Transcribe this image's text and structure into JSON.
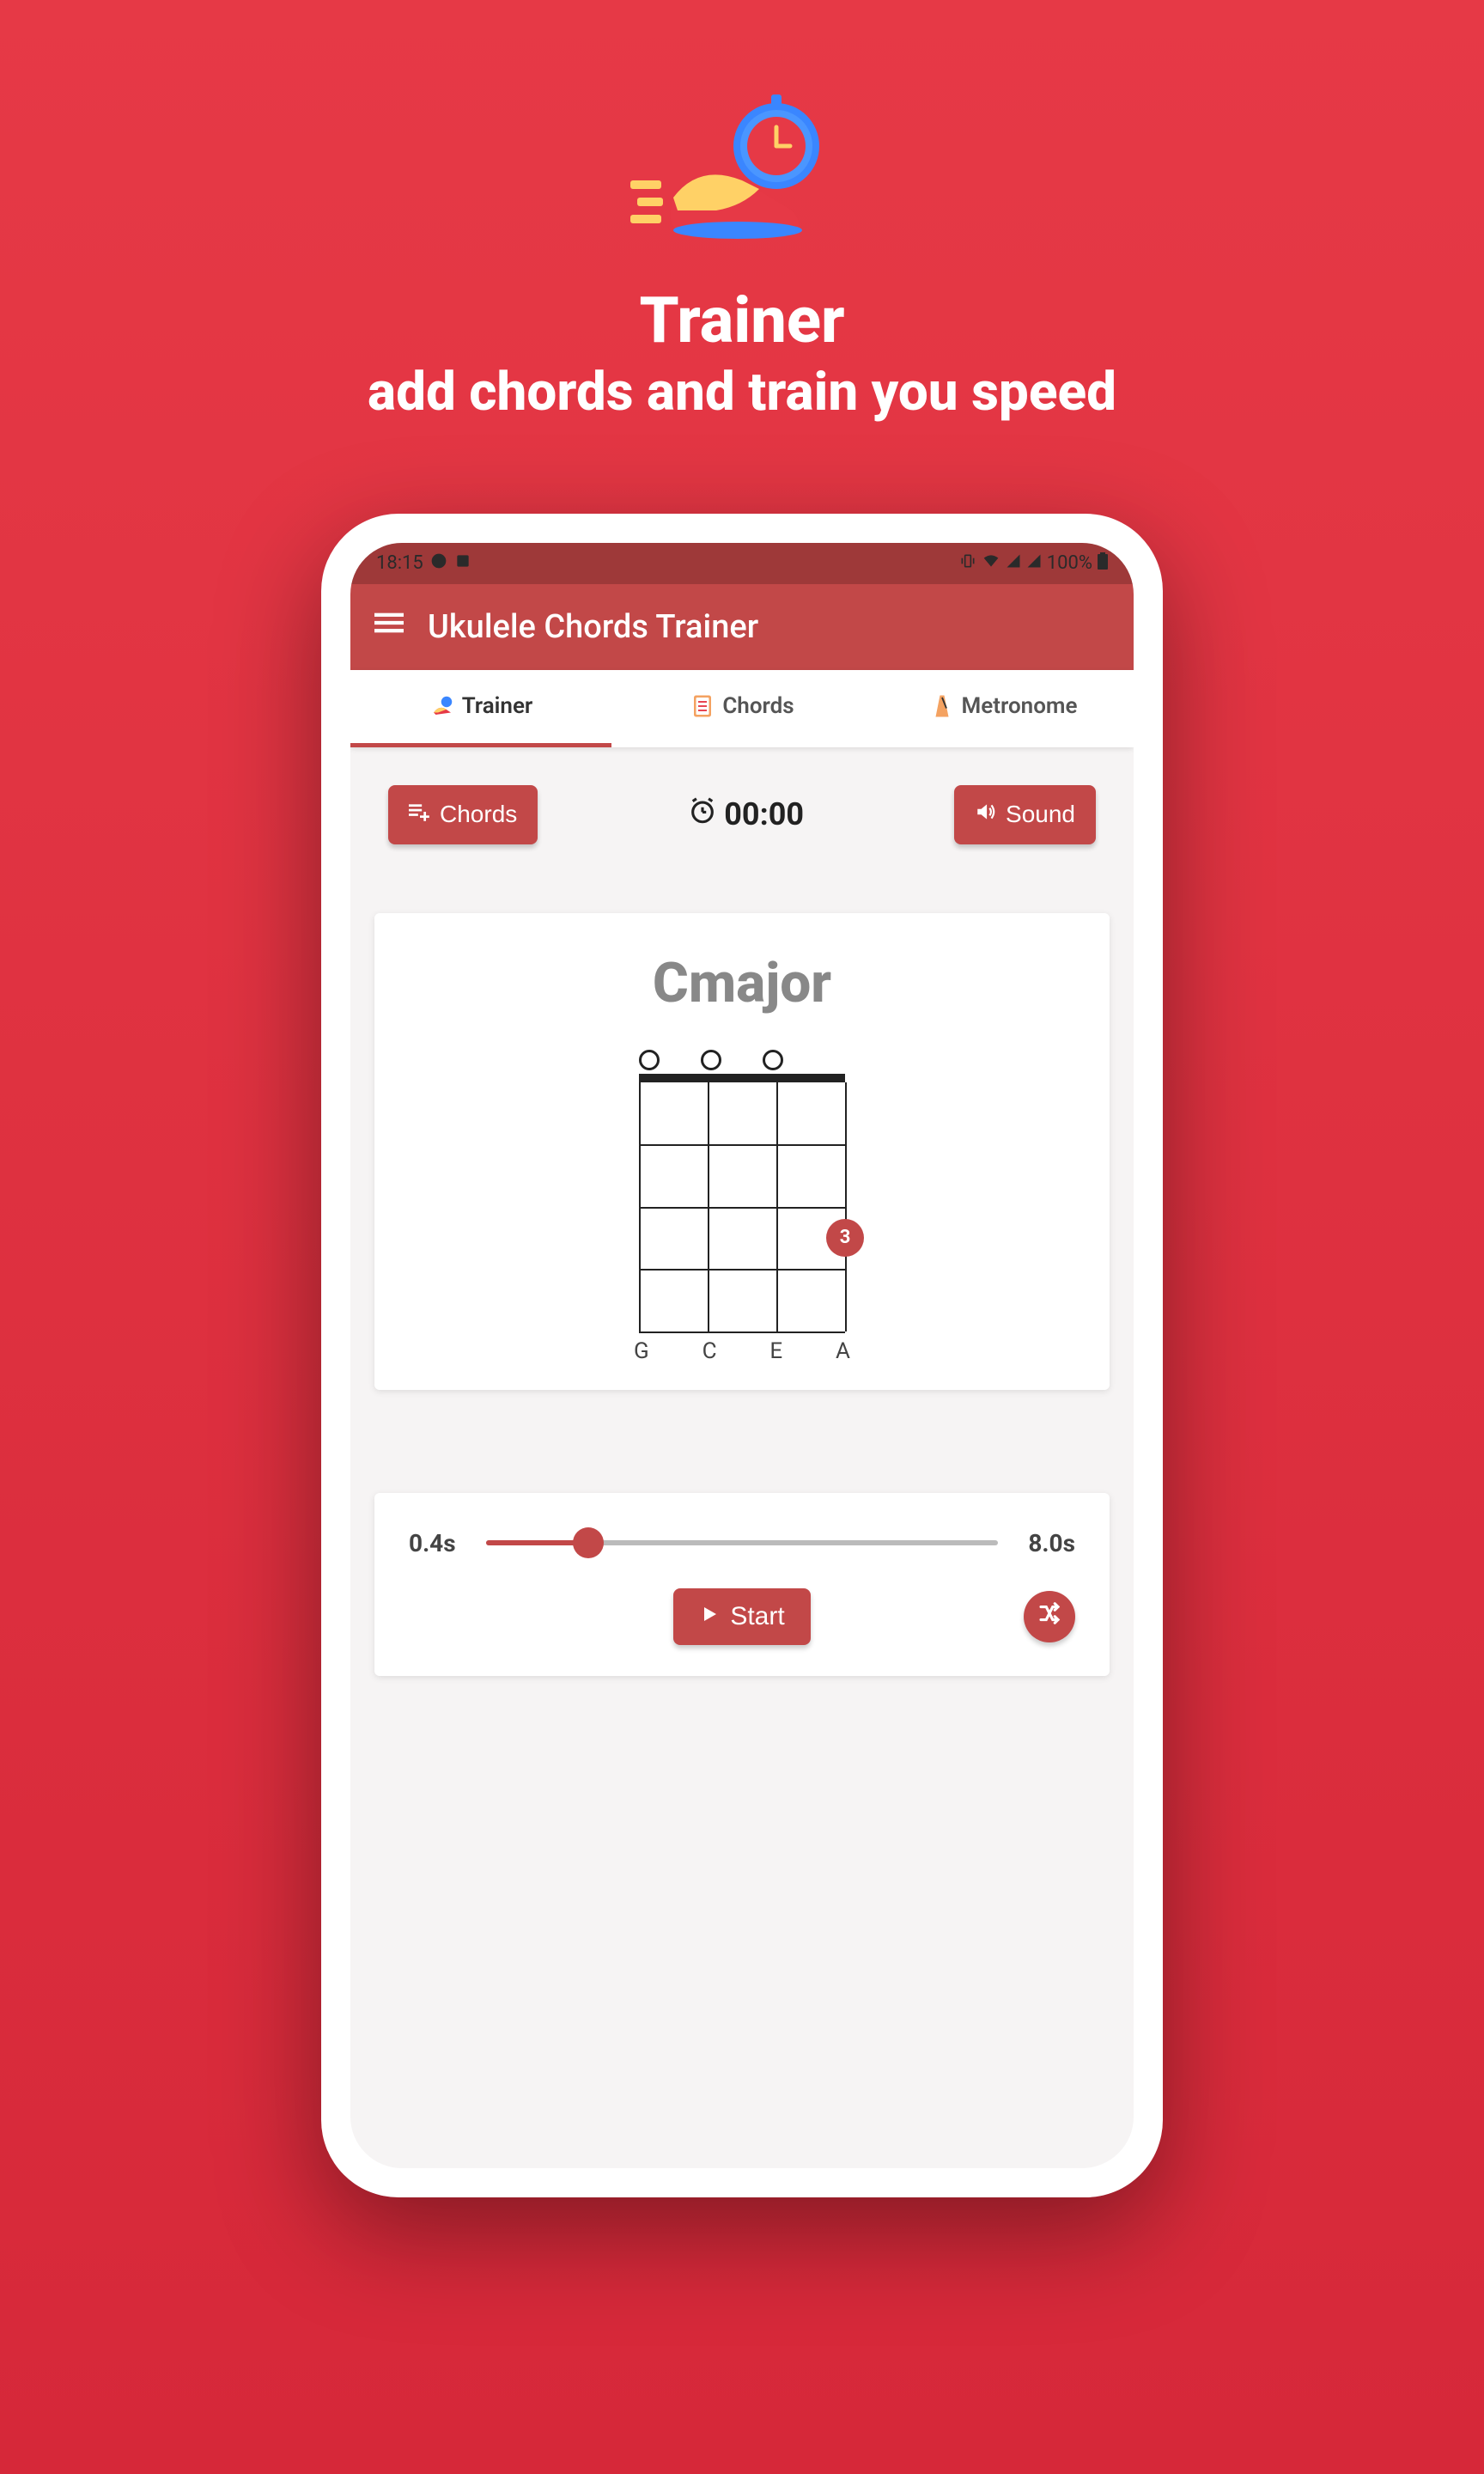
{
  "header": {
    "title": "Trainer",
    "subtitle": "add chords and train you speed"
  },
  "status_bar": {
    "time": "18:15",
    "battery": "100%"
  },
  "app_bar": {
    "title": "Ukulele Chords Trainer"
  },
  "tabs": [
    {
      "label": "Trainer",
      "active": true,
      "icon": "trainer-icon"
    },
    {
      "label": "Chords",
      "active": false,
      "icon": "chords-icon"
    },
    {
      "label": "Metronome",
      "active": false,
      "icon": "metronome-icon"
    }
  ],
  "toolbar": {
    "chords_label": "Chords",
    "timer_value": "00:00",
    "sound_label": "Sound"
  },
  "chord": {
    "name": "Cmajor",
    "strings": [
      "G",
      "C",
      "E",
      "A"
    ],
    "open_strings": [
      true,
      true,
      true,
      false
    ],
    "frets": 4,
    "fingers": [
      {
        "string": 4,
        "fret": 3,
        "finger": "3"
      }
    ]
  },
  "slider": {
    "min_label": "0.4s",
    "max_label": "8.0s",
    "fill_percent": 20
  },
  "actions": {
    "start_label": "Start"
  }
}
